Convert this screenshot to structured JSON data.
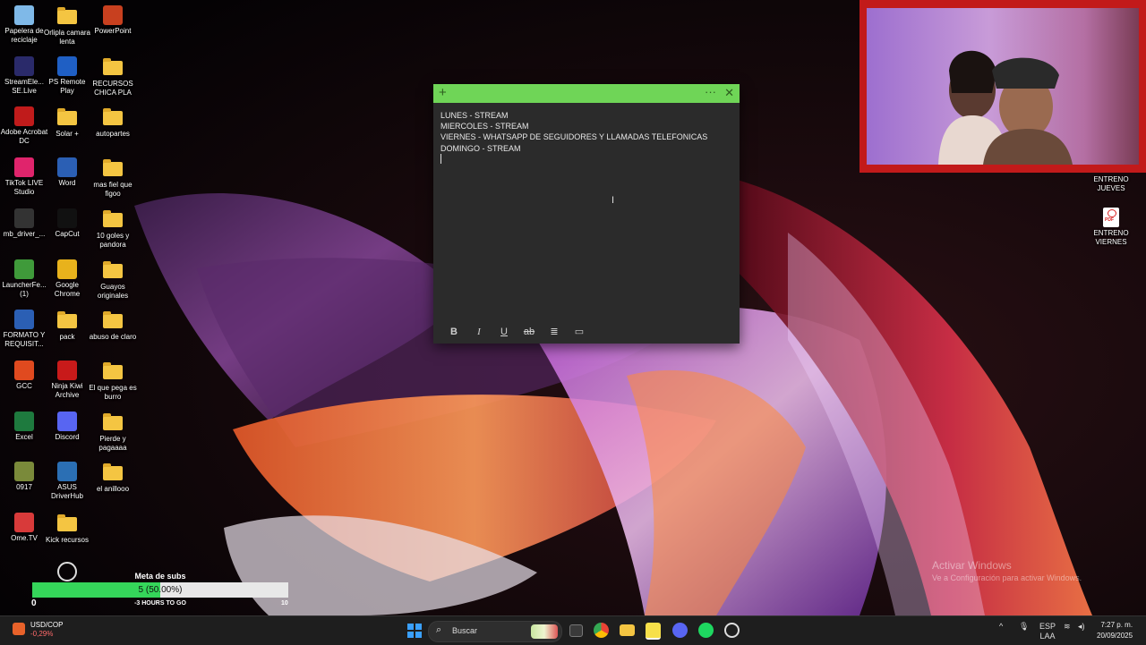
{
  "desktop": {
    "col1": [
      {
        "label": "Papelera de reciclaje",
        "icon": "recycle-bin-icon",
        "color": "#7fb9e8"
      },
      {
        "label": "StreamEle... SE.Live",
        "icon": "streamelements-icon",
        "color": "#2a2a6a"
      },
      {
        "label": "Adobe Acrobat DC",
        "icon": "acrobat-icon",
        "color": "#c01b1b"
      },
      {
        "label": "TikTok LIVE Studio",
        "icon": "tiktok-icon",
        "color": "#e0246c"
      },
      {
        "label": "mb_driver_...",
        "icon": "7z-sfx-icon",
        "color": "#333333"
      },
      {
        "label": "LauncherFe... (1)",
        "icon": "minecraft-icon",
        "color": "#3f9a3a"
      },
      {
        "label": "FORMATO Y REQUISIT...",
        "icon": "word-doc-icon",
        "color": "#2b5fb4"
      },
      {
        "label": "GCC",
        "icon": "gcc-icon",
        "color": "#e04a1f"
      },
      {
        "label": "Excel",
        "icon": "excel-icon",
        "color": "#1e7a3e"
      },
      {
        "label": "0917",
        "icon": "file-icon",
        "color": "#7a8a3a"
      },
      {
        "label": "Ome.TV",
        "icon": "ometv-icon",
        "color": "#d83a3a"
      }
    ],
    "col2": [
      {
        "label": "Orlipla camara lenta",
        "icon": "folder-icon",
        "type": "folder"
      },
      {
        "label": "PS Remote Play",
        "icon": "ps-remote-play-icon",
        "color": "#1f5fc4"
      },
      {
        "label": "Solar +",
        "icon": "folder-icon",
        "type": "folder"
      },
      {
        "label": "Word",
        "icon": "word-icon",
        "color": "#2b5fb4"
      },
      {
        "label": "CapCut",
        "icon": "capcut-icon",
        "color": "#111111"
      },
      {
        "label": "Google Chrome",
        "icon": "chrome-icon",
        "color": "#e8b21c"
      },
      {
        "label": "pack",
        "icon": "folder-icon",
        "type": "folder"
      },
      {
        "label": "Ninja Kiwi Archive",
        "icon": "ninja-kiwi-icon",
        "color": "#c81a1a"
      },
      {
        "label": "Discord",
        "icon": "discord-icon",
        "color": "#5865f2"
      },
      {
        "label": "ASUS DriverHub",
        "icon": "asus-driverhub-icon",
        "color": "#2b6fb4"
      },
      {
        "label": "Kick recursos",
        "icon": "folder-icon",
        "type": "folder"
      }
    ],
    "col3": [
      {
        "label": "PowerPoint",
        "icon": "powerpoint-icon",
        "color": "#c8401f"
      },
      {
        "label": "RECURSOS CHICA PLA",
        "icon": "folder-icon",
        "type": "folder"
      },
      {
        "label": "autopartes",
        "icon": "folder-icon",
        "type": "folder"
      },
      {
        "label": "mas fiel que figoo",
        "icon": "folder-icon",
        "type": "folder"
      },
      {
        "label": "10 goles y pandora",
        "icon": "folder-icon",
        "type": "folder"
      },
      {
        "label": "Guayos originales",
        "icon": "folder-icon",
        "type": "folder"
      },
      {
        "label": "abuso de claro",
        "icon": "folder-icon",
        "type": "folder"
      },
      {
        "label": "El que pega es burro",
        "icon": "folder-icon",
        "type": "folder"
      },
      {
        "label": "Pierde y pagaaaa",
        "icon": "folder-icon",
        "type": "folder"
      },
      {
        "label": "el anillooo",
        "icon": "folder-icon",
        "type": "folder"
      }
    ],
    "right": [
      {
        "label": "ENTRENO JUEVES",
        "icon": "pdf-icon"
      },
      {
        "label": "ENTRENO VIERNES",
        "icon": "pdf-icon"
      }
    ]
  },
  "sticky_note": {
    "lines": [
      "LUNES - STREAM",
      "MIERCOLES - STREAM",
      "VIERNES - WHATSAPP DE SEGUIDORES Y LLAMADAS TELEFONICAS",
      "DOMINGO - STREAM"
    ],
    "add_symbol": "+",
    "menu_symbol": "···",
    "close_symbol": "✕",
    "toolbar": [
      "B",
      "I",
      "U",
      "ab",
      "≣",
      "▭"
    ]
  },
  "meta_subs": {
    "title": "Meta de subs",
    "progress_text": "5 (50.00%)",
    "progress_fraction": 0.5,
    "min_label": "0",
    "time_label": "-3 HOURS TO GO",
    "max_label": "10"
  },
  "activate_windows": {
    "title": "Activar Windows",
    "subtitle": "Ve a Configuración para activar Windows."
  },
  "taskbar": {
    "stock_name": "USD/COP",
    "stock_change": "-0,29%",
    "search_label": "Buscar",
    "language_top": "ESP",
    "language_bottom": "LAA",
    "time": "7:27 p. m.",
    "date": "20/09/2025"
  }
}
